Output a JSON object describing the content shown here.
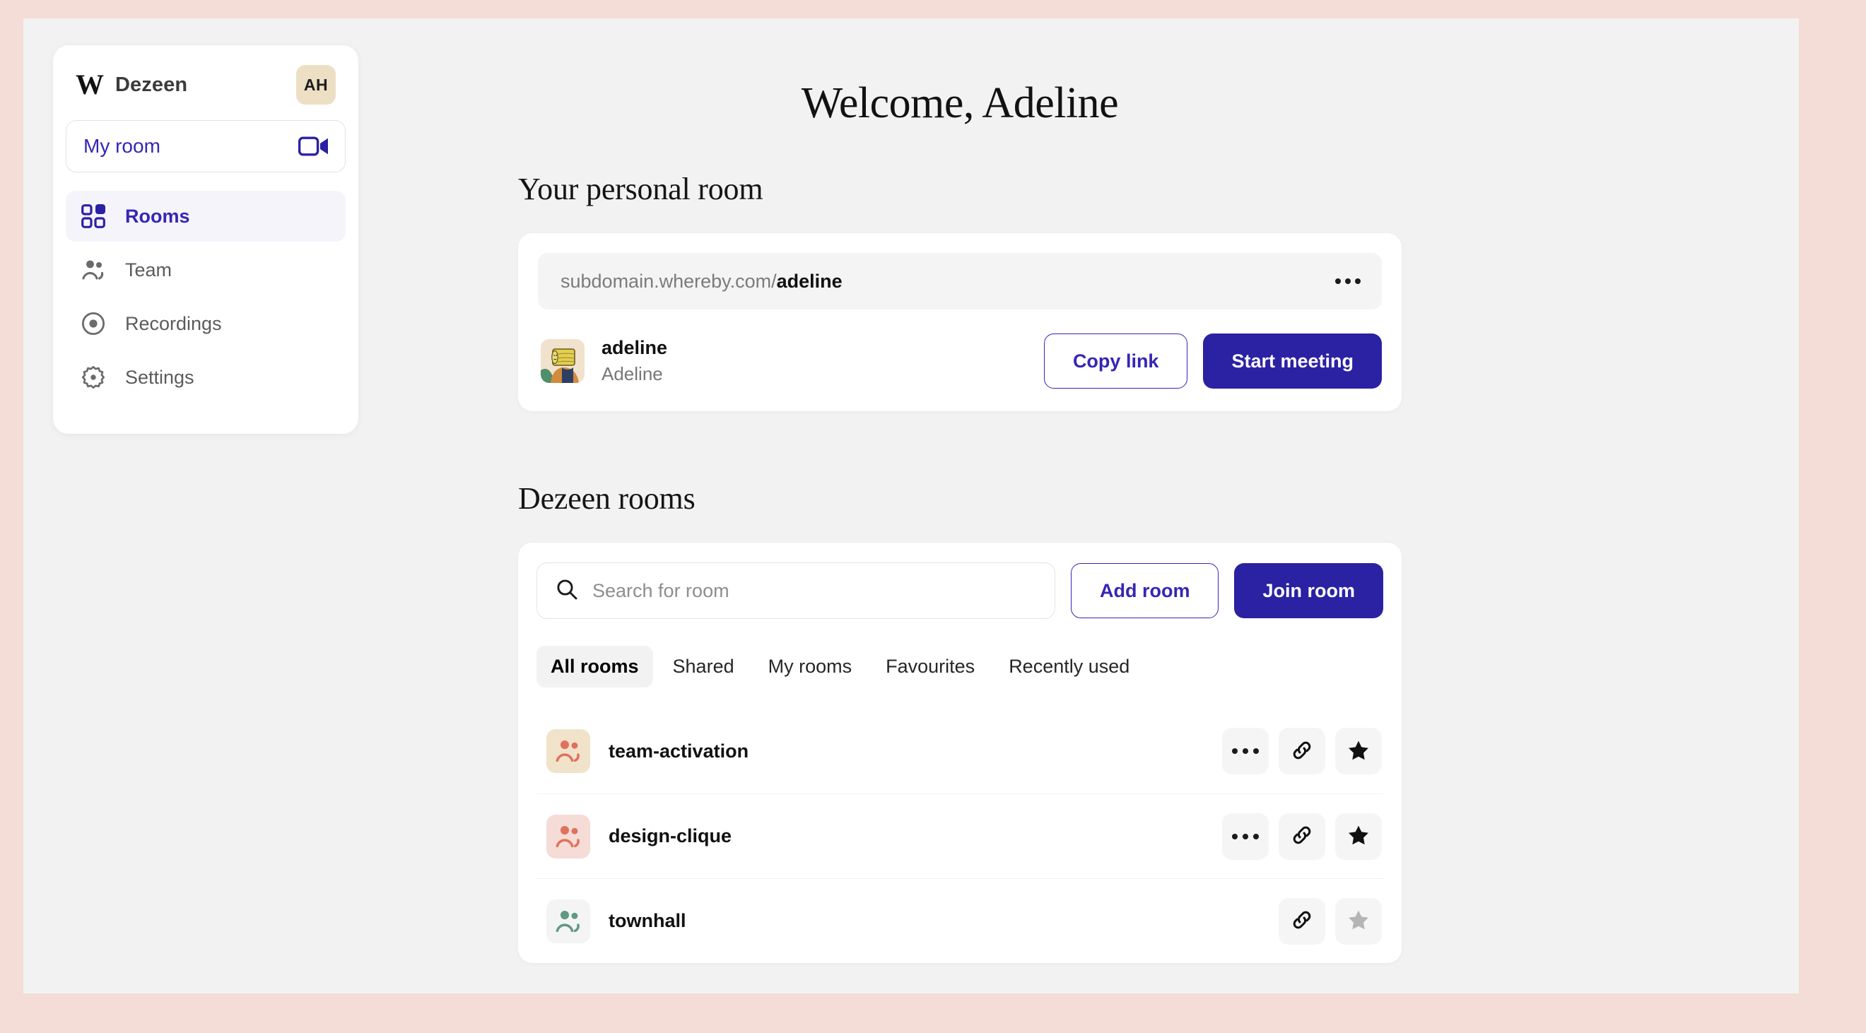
{
  "theme": {
    "page_frame_color": "#f4dcd7",
    "app_background": "#f2f2f2",
    "card_background": "#ffffff",
    "accent_indigo": "#2b21a3",
    "accent_link": "#3526b5",
    "muted_text": "#777777"
  },
  "sidebar": {
    "brand": {
      "logo_glyph": "W",
      "name": "Dezeen",
      "avatar_initials": "AH"
    },
    "my_room_button": {
      "label": "My room",
      "icon": "video-camera-icon"
    },
    "nav_items": [
      {
        "label": "Rooms",
        "icon": "grid-icon",
        "active": true
      },
      {
        "label": "Team",
        "icon": "people-icon",
        "active": false
      },
      {
        "label": "Recordings",
        "icon": "record-icon",
        "active": false
      },
      {
        "label": "Settings",
        "icon": "gear-icon",
        "active": false
      }
    ]
  },
  "main": {
    "welcome_heading": "Welcome, Adeline",
    "personal_room": {
      "section_title": "Your personal room",
      "url_prefix": "subdomain.whereby.com/",
      "url_slug": "adeline",
      "more_icon": "ellipsis-icon",
      "user": {
        "handle": "adeline",
        "full_name": "Adeline",
        "avatar": "illustrated-avatar"
      },
      "copy_link_label": "Copy link",
      "start_meeting_label": "Start meeting"
    },
    "rooms": {
      "section_title": "Dezeen rooms",
      "search_placeholder": "Search for room",
      "search_value": "",
      "search_icon": "search-icon",
      "add_room_label": "Add room",
      "join_room_label": "Join room",
      "tabs": [
        {
          "label": "All rooms",
          "active": true
        },
        {
          "label": "Shared",
          "active": false
        },
        {
          "label": "My rooms",
          "active": false
        },
        {
          "label": "Favourites",
          "active": false
        },
        {
          "label": "Recently used",
          "active": false
        }
      ],
      "list": [
        {
          "name": "team-activation",
          "avatar_bg": "#f0e3c9",
          "avatar_fg": "#e0725d",
          "has_more": true,
          "favourited": true
        },
        {
          "name": "design-clique",
          "avatar_bg": "#f5dcd7",
          "avatar_fg": "#e0725d",
          "has_more": true,
          "favourited": true
        },
        {
          "name": "townhall",
          "avatar_bg": "#f4f4f4",
          "avatar_fg": "#5f9a81",
          "has_more": false,
          "favourited": false
        }
      ],
      "row_icons": {
        "more": "ellipsis-icon",
        "link": "link-icon",
        "favourite": "star-icon"
      }
    }
  }
}
